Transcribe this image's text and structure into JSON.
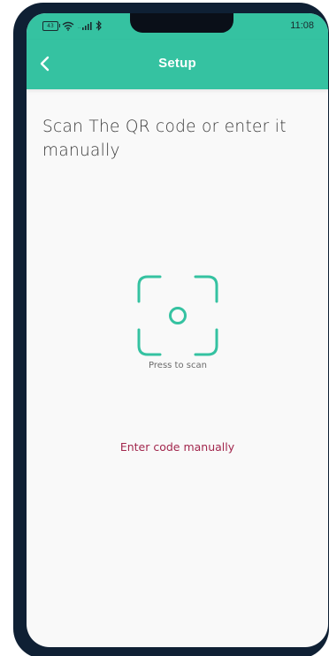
{
  "status_bar": {
    "battery_level": "43",
    "time": "11:08",
    "icons": [
      "battery-icon",
      "wifi-icon",
      "signal-icon",
      "bluetooth-icon"
    ]
  },
  "app_bar": {
    "title": "Setup",
    "back_icon": "chevron-left-icon"
  },
  "main": {
    "instruction": "Scan The QR code or enter it manually",
    "scan_label": "Press to scan",
    "manual_link": "Enter code manually"
  },
  "colors": {
    "accent": "#35c2a1",
    "link": "#a2274d",
    "background": "#f9f9f9",
    "frame": "#0f2034"
  }
}
